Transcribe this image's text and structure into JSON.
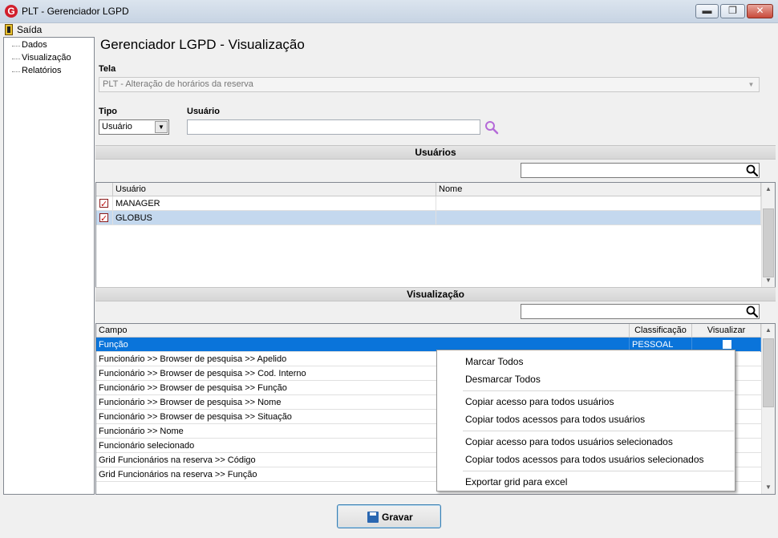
{
  "window": {
    "title": "PLT - Gerenciador LGPD",
    "app_icon_letter": "G",
    "buttons": {
      "minimize": "▬",
      "maximize": "❐",
      "close": "✕"
    }
  },
  "menu": {
    "exit_label": "Saída"
  },
  "tree": {
    "items": [
      "Dados",
      "Visualização",
      "Relatórios"
    ]
  },
  "main": {
    "title": "Gerenciador LGPD - Visualização",
    "tela_label": "Tela",
    "tela_value": "PLT - Alteração de horários da reserva",
    "tipo_label": "Tipo",
    "tipo_value": "Usuário",
    "usuario_label": "Usuário",
    "usuario_value": ""
  },
  "users_section": {
    "title": "Usuários",
    "filter_value": "",
    "columns": [
      "Usuário",
      "Nome"
    ],
    "rows": [
      {
        "checked": true,
        "usuario": "MANAGER",
        "nome": ""
      },
      {
        "checked": true,
        "usuario": "GLOBUS",
        "nome": ""
      }
    ]
  },
  "view_section": {
    "title": "Visualização",
    "filter_value": "",
    "columns": [
      "Campo",
      "Classificação",
      "Visualizar"
    ],
    "rows": [
      {
        "campo": "Função",
        "classificacao": "PESSOAL",
        "visualizar": false
      },
      {
        "campo": "Funcionário >> Browser de pesquisa >> Apelido"
      },
      {
        "campo": "Funcionário >> Browser de pesquisa >> Cod. Interno"
      },
      {
        "campo": "Funcionário >> Browser de pesquisa >> Função"
      },
      {
        "campo": "Funcionário >> Browser de pesquisa >> Nome"
      },
      {
        "campo": "Funcionário >> Browser de pesquisa >> Situação"
      },
      {
        "campo": "Funcionário >> Nome"
      },
      {
        "campo": "Funcionário selecionado"
      },
      {
        "campo": "Grid Funcionários na reserva >> Código"
      },
      {
        "campo": "Grid Funcionários na reserva >> Função"
      }
    ]
  },
  "context_menu": {
    "items": [
      "Marcar Todos",
      "Desmarcar Todos",
      "Copiar acesso para todos usuários",
      "Copiar todos acessos para todos usuários",
      "Copiar acesso para todos usuários selecionados",
      "Copiar todos acessos para todos usuários selecionados",
      "Exportar grid para excel"
    ]
  },
  "save_button": {
    "label": "Gravar"
  },
  "colors": {
    "selection": "#0a74da",
    "selection_light": "#c4d8ee",
    "brand_red": "#d11f2c",
    "search_icon": "#b56ad8"
  },
  "icons": [
    "app-logo-icon",
    "exit-door-icon",
    "magnifier-icon",
    "floppy-save-icon",
    "checkbox-icon"
  ]
}
